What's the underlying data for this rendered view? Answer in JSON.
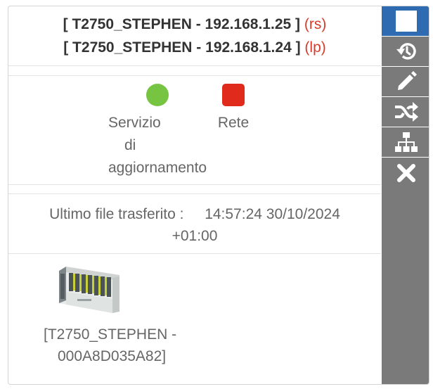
{
  "connections": [
    {
      "label": "[ T2750_STEPHEN - 192.168.1.25 ]",
      "tag": "(rs)"
    },
    {
      "label": "[ T2750_STEPHEN - 192.168.1.24 ]",
      "tag": "(lp)"
    }
  ],
  "status": [
    {
      "label_lines": [
        "Servizio",
        "di",
        "aggiornamento"
      ],
      "color": "#76c442",
      "shape": "circle"
    },
    {
      "label_lines": [
        "Rete"
      ],
      "color": "#e02a1c",
      "shape": "square"
    }
  ],
  "transfer": {
    "label": "Ultimo file trasferito :",
    "time": "14:57:24 30/10/2024",
    "offset": "+01:00"
  },
  "device": {
    "name_lines": [
      "[T2750_STEPHEN -",
      "000A8D035A82]"
    ],
    "image": "plc-rack-image"
  },
  "sidebar": {
    "buttons": [
      {
        "icon": "stop-square-icon",
        "active": true
      },
      {
        "icon": "history-icon",
        "active": false
      },
      {
        "icon": "pencil-icon",
        "active": false
      },
      {
        "icon": "shuffle-icon",
        "active": false
      },
      {
        "icon": "sitemap-icon",
        "active": false
      },
      {
        "icon": "close-icon",
        "active": false
      }
    ]
  },
  "colors": {
    "tag_red": "#d63b2b",
    "sidebar_bg": "#7a7a7a",
    "sidebar_active": "#2e6bb0",
    "text_dark": "#333333",
    "text_muted": "#666666"
  }
}
